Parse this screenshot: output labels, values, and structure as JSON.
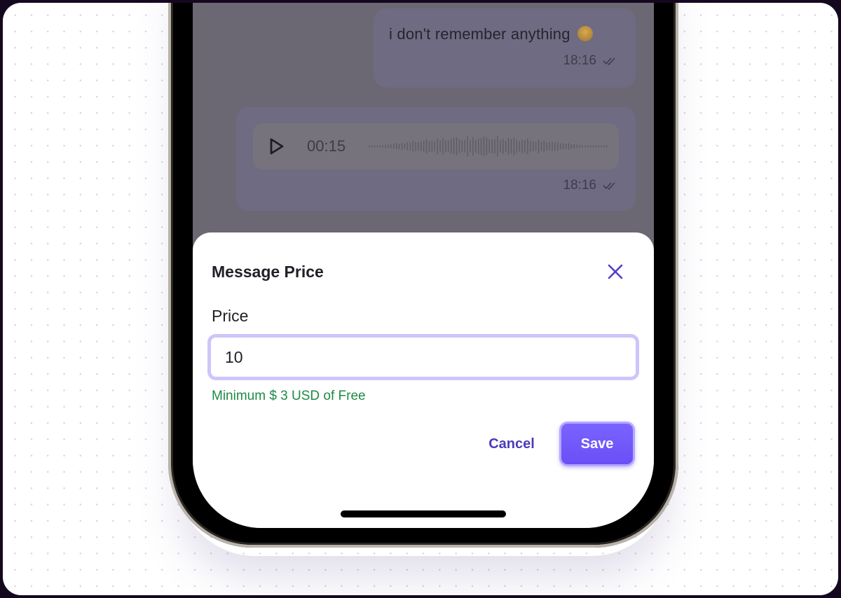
{
  "chat": {
    "messages": [
      {
        "type": "text",
        "text": "i don't remember anything",
        "emoji": "rolling-on-floor-laughing",
        "time": "18:16",
        "status": "read"
      },
      {
        "type": "voice",
        "duration": "00:15",
        "time": "18:16",
        "status": "read"
      }
    ]
  },
  "sheet": {
    "title": "Message Price",
    "close_icon": "close-x-icon",
    "field_label": "Price",
    "input_value": "10",
    "helper_text": "Minimum $ 3 USD of Free",
    "cancel_label": "Cancel",
    "save_label": "Save"
  },
  "colors": {
    "accent": "#6a4ff6",
    "accent_text": "#4b3aba",
    "input_focus_ring": "#cdc5fb",
    "helper_success": "#1e8a45",
    "overlay_bubble": "#6f6b82"
  }
}
